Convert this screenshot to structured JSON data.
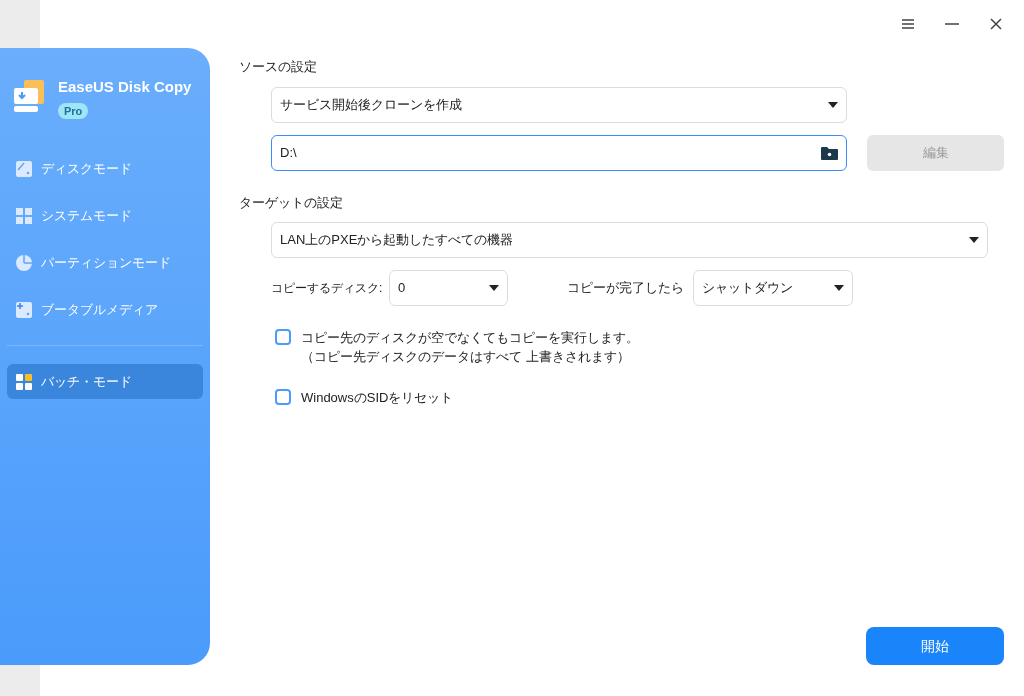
{
  "window_controls": [
    {
      "kind": "menu"
    },
    {
      "kind": "minimize"
    },
    {
      "kind": "close"
    }
  ],
  "sidebar": {
    "app_name": "EaseUS Disk Copy",
    "badge": "Pro",
    "items": [
      {
        "label": "ディスクモード",
        "kind": "disk",
        "selected": false
      },
      {
        "label": "システムモード",
        "kind": "windows",
        "selected": false
      },
      {
        "label": "パーティションモード",
        "kind": "pie",
        "selected": false
      },
      {
        "label": "ブータブルメディア",
        "kind": "media",
        "selected": false
      },
      {
        "label": "バッチ・モード",
        "kind": "batch",
        "selected": true
      }
    ]
  },
  "source": {
    "heading": "ソースの設定",
    "mode": "サービス開始後クローンを作成",
    "path": "D:\\",
    "edit_button": "編集",
    "edit_disabled": true
  },
  "target": {
    "heading": "ターゲットの設定",
    "devices": "LAN上のPXEから起動したすべての機器",
    "disk_label": "コピーするディスク:",
    "disk_value": "0",
    "after_label": "コピーが完了したら",
    "after_value": "シャットダウン",
    "options": [
      {
        "label": "コピー先のディスクが空でなくてもコピーを実行します。",
        "note": "（コピー先ディスクのデータはすべて 上書きされます）",
        "checked": false
      },
      {
        "label": "WindowsのSIDをリセット",
        "checked": false
      }
    ]
  },
  "start_button": "開始"
}
